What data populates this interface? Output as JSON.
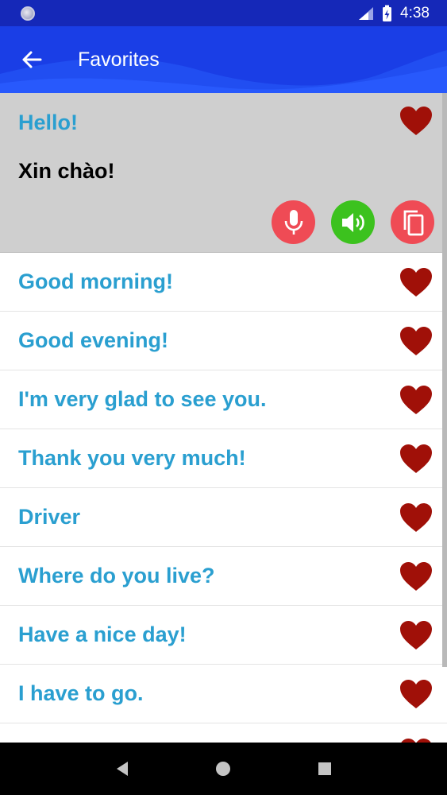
{
  "status_bar": {
    "time": "4:38"
  },
  "app_bar": {
    "title": "Favorites"
  },
  "expanded_item": {
    "phrase": "Hello!",
    "translation": "Xin chào!"
  },
  "items": [
    {
      "phrase": "Good morning!"
    },
    {
      "phrase": "Good evening!"
    },
    {
      "phrase": "I'm very glad to see you."
    },
    {
      "phrase": "Thank you very much!"
    },
    {
      "phrase": "Driver"
    },
    {
      "phrase": "Where do you live?"
    },
    {
      "phrase": "Have a nice day!"
    },
    {
      "phrase": "I have to go."
    }
  ],
  "colors": {
    "status_bar": "#1528b8",
    "app_bar": "#1a3ee6",
    "phrase_text": "#2a9fd0",
    "heart": "#a01008",
    "mic_button": "#ef4b55",
    "speaker_button": "#3cc21e",
    "copy_button": "#ef4b55"
  },
  "icons": {
    "back": "arrow-left-icon",
    "favorite": "heart-icon",
    "mic": "microphone-icon",
    "speaker": "speaker-icon",
    "copy": "copy-icon"
  }
}
